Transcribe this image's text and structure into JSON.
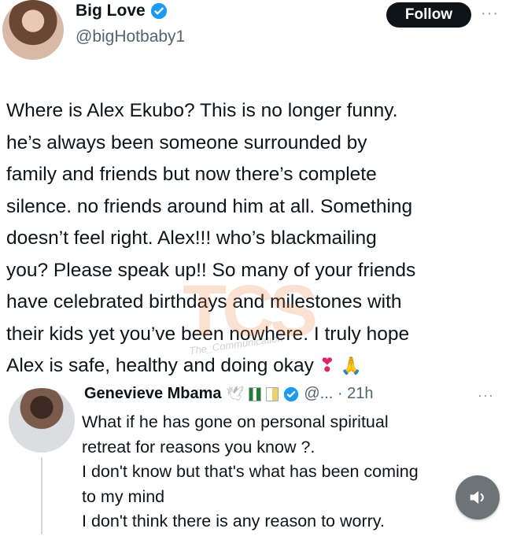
{
  "post": {
    "author_name": "Big Love",
    "handle": "@bigHotbaby1",
    "follow_label": "Follow",
    "more_label": "···",
    "lines": [
      "Where is Alex Ekubo? This is no longer funny.",
      "he’s always been someone surrounded by",
      "family and friends but now there’s complete",
      "silence. no friends around him at all. Something",
      "doesn’t feel right. Alex!!! who’s blackmailing",
      "you? Please speak up!! So many of your friends",
      "have celebrated birthdays and milestones with",
      "their kids yet you’ve been nowhere. I truly hope",
      "Alex is safe, healthy and doing okay"
    ],
    "emoji_heart": "❣",
    "emoji_pray": "🙏"
  },
  "watermark": {
    "logo": "TCS",
    "caption": "The_Communication"
  },
  "reply": {
    "author_name": "Genevieve Mbama",
    "handle_time": "@... · 21h",
    "more_label": "···",
    "lines": [
      "What if he has gone on personal spiritual",
      "retreat for reasons you know ?.",
      "I don't know but that's what has been coming",
      "to my mind",
      " I don't think there is any reason to worry."
    ]
  },
  "colors": {
    "verified": "#1d9bf0",
    "follow_bg": "#0f1419"
  },
  "icons": {
    "verified": "verified-badge-icon",
    "audio": "speaker-icon"
  }
}
